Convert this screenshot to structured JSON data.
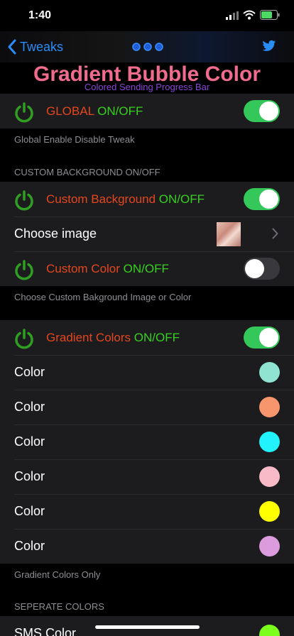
{
  "status": {
    "time": "1:40"
  },
  "nav": {
    "back_label": "Tweaks"
  },
  "header": {
    "title": "Gradient Bubble Color",
    "subtitle": "Colored Sending Progress Bar"
  },
  "global": {
    "label_main": "GLOBAL",
    "label_suffix": " ON/OFF",
    "enabled": true,
    "footer": "Global Enable Disable Tweak"
  },
  "custom_background": {
    "section_title": "CUSTOM BACKGROUND ON/OFF",
    "bg_label_main": "Custom Background",
    "bg_label_suffix": " ON/OFF",
    "bg_enabled": true,
    "choose_image_label": "Choose image",
    "color_label_main": "Custom Color",
    "color_label_suffix": " ON/OFF",
    "color_enabled": false,
    "footer": "Choose Custom Bakground Image or Color"
  },
  "gradient": {
    "label_main": "Gradient Colors",
    "label_suffix": " ON/OFF",
    "enabled": true,
    "colors": [
      {
        "label": "Color",
        "value": "#8fe3d0"
      },
      {
        "label": "Color",
        "value": "#f7956c"
      },
      {
        "label": "Color",
        "value": "#22f2fc"
      },
      {
        "label": "Color",
        "value": "#f8bac6"
      },
      {
        "label": "Color",
        "value": "#ffff00"
      },
      {
        "label": "Color",
        "value": "#dc9bdd"
      }
    ],
    "footer": "Gradient Colors Only"
  },
  "separate": {
    "section_title": "SEPERATE COLORS",
    "sms_label": "SMS Color",
    "sms_color": "#7bff1c"
  },
  "icons": {
    "power": "power-icon",
    "twitter": "twitter-icon",
    "back": "chevron-left-icon",
    "disclosure": "chevron-right-icon"
  },
  "colors": {
    "accent": "#2a8cf7",
    "title": "#f06b8e",
    "subtitle": "#8a45d9",
    "toggle_on": "#34c759",
    "power": "#2f9e23"
  }
}
